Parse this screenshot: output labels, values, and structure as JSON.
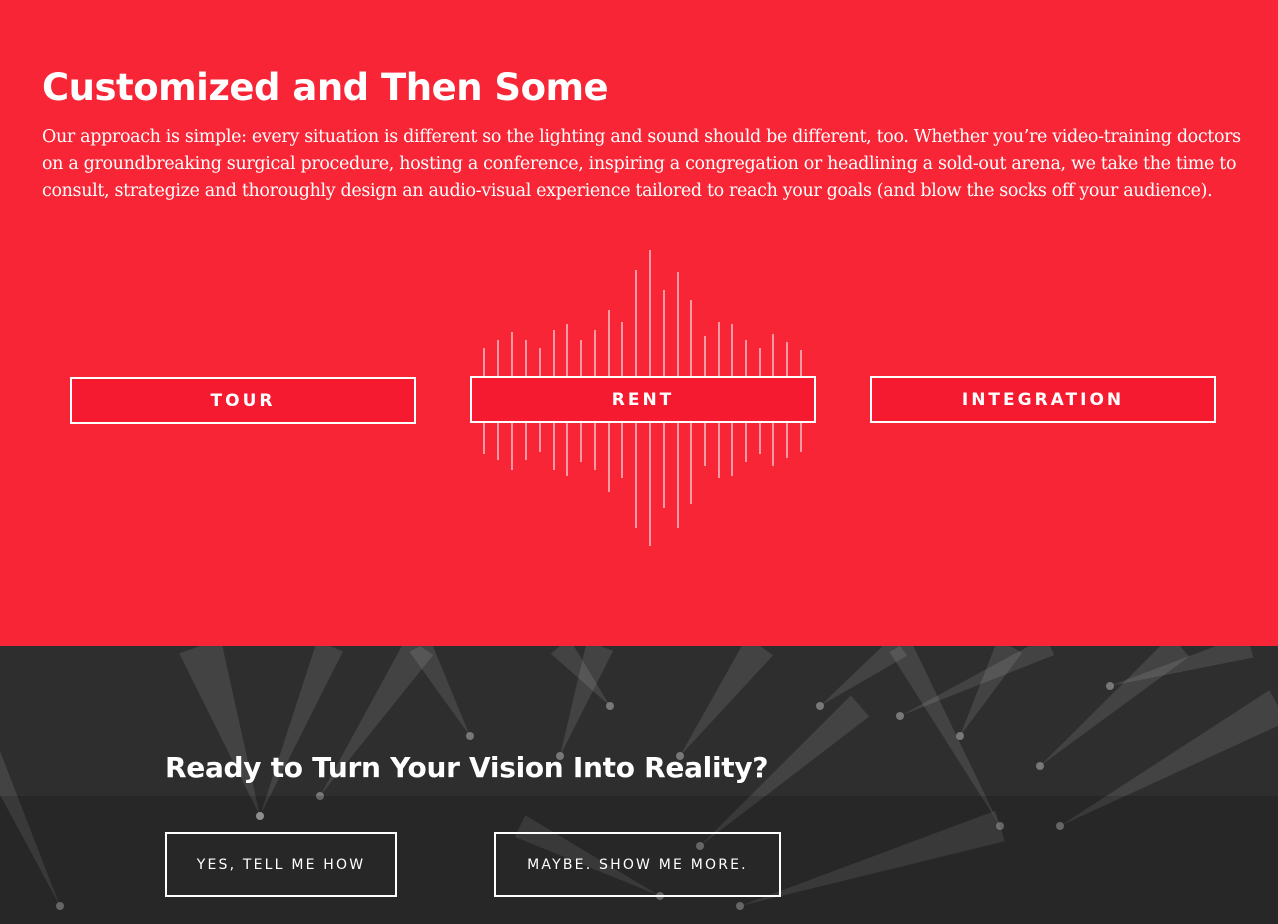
{
  "colors": {
    "hero_background": "#f72535",
    "button_fill": "#f51a30",
    "cta_background": "#2e2e2e",
    "text": "#ffffff"
  },
  "hero": {
    "title": "Customized and Then Some",
    "body": "Our approach is simple: every situation is different so the lighting and sound should be different, too. Whether you’re video-training doctors on a groundbreaking surgical procedure, hosting a conference, inspiring a congregation or headlining a sold-out arena, we take the time to consult, strategize and thoroughly design an audio-visual experience tailored to reach your goals (and blow the socks off your audience).",
    "decoration": "sound-wave-graphic"
  },
  "services": {
    "tour_label": "TOUR",
    "rent_label": "RENT",
    "integration_label": "INTEGRATION"
  },
  "cta": {
    "title": "Ready to Turn Your Vision Into Reality?",
    "primary_label": "YES, TELL ME HOW",
    "secondary_label": "MAYBE. SHOW ME MORE.",
    "background": "concert-light-beams-photo"
  }
}
